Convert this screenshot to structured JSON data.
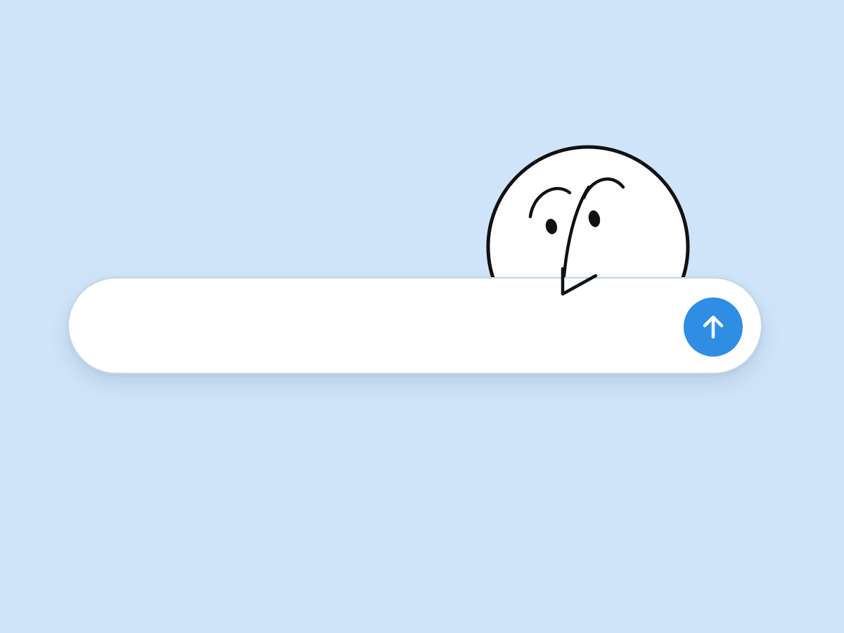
{
  "composer": {
    "input": {
      "value": "",
      "placeholder": ""
    },
    "send_button": {
      "icon": "arrow-up-icon",
      "color": "#2f8de4",
      "icon_color": "#ffffff"
    }
  },
  "mascot": {
    "icon": "peeking-face-illustration",
    "fill": "#ffffff",
    "stroke": "#111111"
  },
  "theme": {
    "background": "#cfe4f8",
    "bar_background": "#ffffff",
    "bar_border": "#c3d6e7"
  }
}
